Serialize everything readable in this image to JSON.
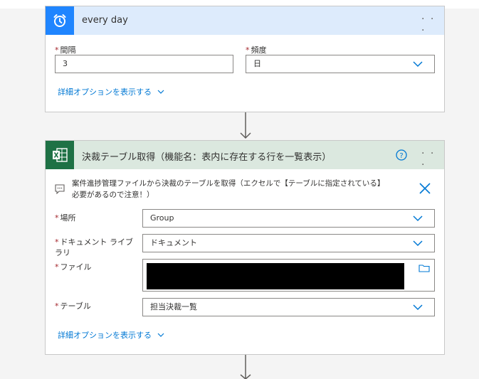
{
  "recurrence_card": {
    "title": "every day",
    "more": "· · ·",
    "interval_label": "間隔",
    "interval_value": "3",
    "frequency_label": "頻度",
    "frequency_value": "日",
    "advanced_link": "詳細オプションを表示する"
  },
  "excel_card": {
    "title": "決裁テーブル取得（機能名：表内に存在する行を一覧表示）",
    "more": "· · ·",
    "comment_line1": "案件進捗管理ファイルから決裁のテーブルを取得（エクセルで【テーブルに指定されている】",
    "comment_line2": "必要があるので注意！）",
    "location_label": "場所",
    "location_value": "Group",
    "library_label_line1": "ドキュメント ライブ",
    "library_label_line2": "ラリ",
    "library_value": "ドキュメント",
    "file_label": "ファイル",
    "table_label": "テーブル",
    "table_value": "担当決裁一覧",
    "advanced_link": "詳細オプションを表示する"
  },
  "colors": {
    "recurrence_header": "#ddebfc",
    "recurrence_icon": "#1f85ff",
    "excel_header": "#dbe8df",
    "excel_icon": "#1e7145",
    "link": "#0078d4",
    "required": "#a4262c"
  }
}
